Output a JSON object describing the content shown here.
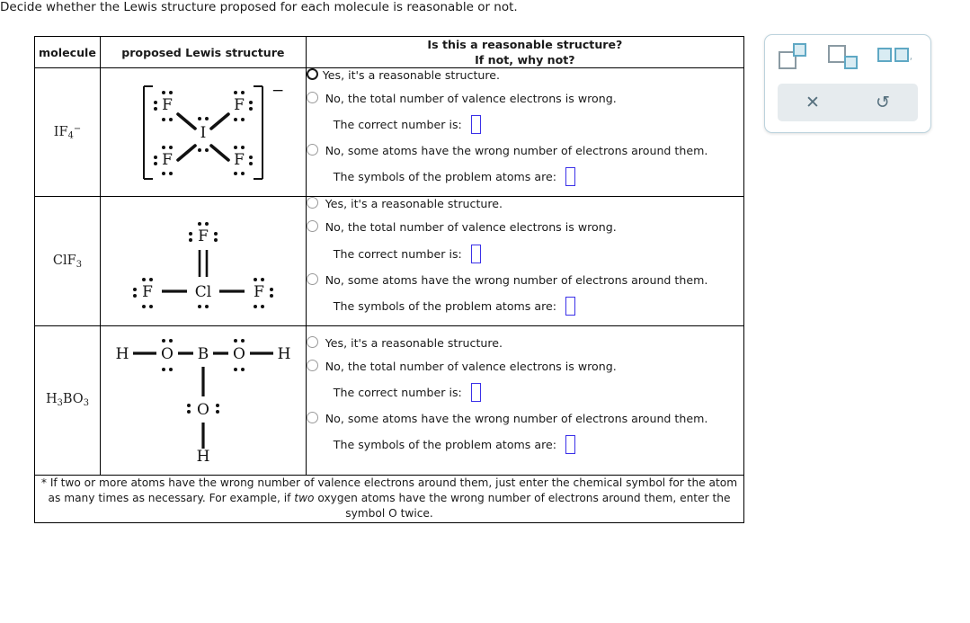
{
  "prompt": "Decide whether the Lewis structure proposed for each molecule is reasonable or not.",
  "table": {
    "headers": {
      "molecule": "molecule",
      "structure": "proposed Lewis structure",
      "answer_line1": "Is this a reasonable structure?",
      "answer_line2": "If not, why not?"
    },
    "rows": [
      {
        "molecule": {
          "formula": "IF",
          "sub": "4",
          "sup": "−"
        },
        "structure": {
          "id": "if4-minus",
          "atoms": [
            "F",
            "F",
            "I",
            "F",
            "F"
          ],
          "charge": "−",
          "brackets": true
        },
        "options": [
          {
            "label": "Yes, it's a reasonable structure.",
            "selected": false,
            "highlighted": true
          },
          {
            "label": "No, the total number of valence electrons is wrong.",
            "selected": false,
            "highlighted": false
          },
          {
            "label": "No, some atoms have the wrong number of electrons around them.",
            "selected": false,
            "highlighted": false
          }
        ],
        "fields": [
          {
            "label": "The correct number is:",
            "value": ""
          },
          {
            "label": "The symbols of the problem atoms are:",
            "value": ""
          }
        ]
      },
      {
        "molecule": {
          "formula": "ClF",
          "sub": "3",
          "sup": ""
        },
        "structure": {
          "id": "clf3",
          "atoms": [
            "F",
            "F",
            "Cl",
            "F"
          ],
          "charge": "",
          "brackets": false
        },
        "options": [
          {
            "label": "Yes, it's a reasonable structure.",
            "selected": false,
            "highlighted": false
          },
          {
            "label": "No, the total number of valence electrons is wrong.",
            "selected": false,
            "highlighted": false
          },
          {
            "label": "No, some atoms have the wrong number of electrons around them.",
            "selected": false,
            "highlighted": false
          }
        ],
        "fields": [
          {
            "label": "The correct number is:",
            "value": ""
          },
          {
            "label": "The symbols of the problem atoms are:",
            "value": ""
          }
        ]
      },
      {
        "molecule": {
          "formula": "H",
          "sub": "3",
          "sup": "",
          "formula2": "BO",
          "sub2": "3"
        },
        "structure": {
          "id": "h3bo3",
          "atoms": [
            "H",
            "O",
            "B",
            "O",
            "H",
            "O",
            "H"
          ],
          "charge": "",
          "brackets": false
        },
        "options": [
          {
            "label": "Yes, it's a reasonable structure.",
            "selected": false,
            "highlighted": false
          },
          {
            "label": "No, the total number of valence electrons is wrong.",
            "selected": false,
            "highlighted": false
          },
          {
            "label": "No, some atoms have the wrong number of electrons around them.",
            "selected": false,
            "highlighted": false
          }
        ],
        "fields": [
          {
            "label": "The correct number is:",
            "value": ""
          },
          {
            "label": "The symbols of the problem atoms are:",
            "value": ""
          }
        ]
      }
    ],
    "footnote": {
      "part1": "* If two or more atoms have the wrong number of valence electrons around them, just enter the chemical symbol for the atom as many times as necessary. For example, if ",
      "italic": "two",
      "part2": " oxygen atoms have the wrong number of electrons around them, enter the symbol O twice."
    }
  },
  "toolbar": {
    "icons": [
      {
        "name": "superscript-icon",
        "title": "superscript"
      },
      {
        "name": "subscript-icon",
        "title": "subscript"
      },
      {
        "name": "symbol-list-icon",
        "title": "list of symbols",
        "ellipsis": ",   "
      }
    ],
    "buttons": [
      {
        "name": "clear-button",
        "glyph": "✕"
      },
      {
        "name": "undo-button",
        "glyph": "↺"
      }
    ],
    "colors": {
      "teal": "#5fa8c4",
      "teal_fill": "#d9ecf3",
      "gray": "#8a9aa3",
      "bar": "#e6ebee",
      "icon": "#56707e"
    }
  },
  "colors": {
    "input_border": "#3b31e8",
    "table_border": "#000000",
    "text": "#1a1a1a"
  }
}
